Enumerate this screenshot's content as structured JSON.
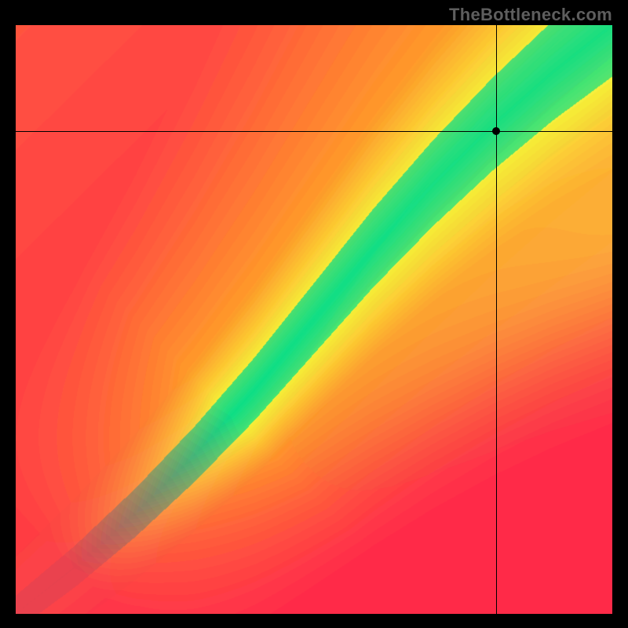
{
  "watermark": "TheBottleneck.com",
  "chart_data": {
    "type": "heatmap",
    "title": "",
    "xlabel": "",
    "ylabel": "",
    "x_range": [
      0,
      100
    ],
    "y_range": [
      0,
      100
    ],
    "crosshair": {
      "x": 80.5,
      "y": 82
    },
    "marker": {
      "x": 80.5,
      "y": 82
    },
    "optimal_curve": {
      "description": "Green optimal diagonal band from lower-left toward upper-right; curve bows so balanced point is slightly right/above center. Warm gradient (red→orange→yellow) fills regions away from the band on both sides.",
      "points_xy": [
        [
          0,
          0
        ],
        [
          10,
          8
        ],
        [
          20,
          17
        ],
        [
          30,
          27
        ],
        [
          40,
          38
        ],
        [
          50,
          50
        ],
        [
          60,
          62
        ],
        [
          70,
          73
        ],
        [
          80,
          83
        ],
        [
          90,
          92
        ],
        [
          100,
          100
        ]
      ],
      "band_halfwidth_approx": 5
    },
    "color_scale": {
      "optimal": "#00e08a",
      "near": "#f6f23a",
      "mid": "#ff9a2a",
      "far": "#ff2b4a"
    }
  }
}
